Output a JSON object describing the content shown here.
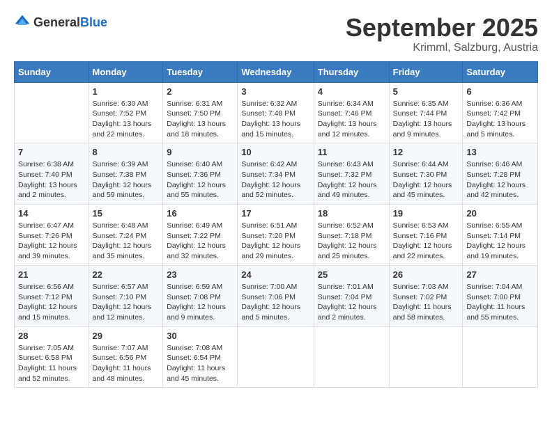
{
  "logo": {
    "general": "General",
    "blue": "Blue"
  },
  "title": "September 2025",
  "location": "Krimml, Salzburg, Austria",
  "days_of_week": [
    "Sunday",
    "Monday",
    "Tuesday",
    "Wednesday",
    "Thursday",
    "Friday",
    "Saturday"
  ],
  "weeks": [
    [
      {
        "day": "",
        "sunrise": "",
        "sunset": "",
        "daylight": ""
      },
      {
        "day": "1",
        "sunrise": "Sunrise: 6:30 AM",
        "sunset": "Sunset: 7:52 PM",
        "daylight": "Daylight: 13 hours and 22 minutes."
      },
      {
        "day": "2",
        "sunrise": "Sunrise: 6:31 AM",
        "sunset": "Sunset: 7:50 PM",
        "daylight": "Daylight: 13 hours and 18 minutes."
      },
      {
        "day": "3",
        "sunrise": "Sunrise: 6:32 AM",
        "sunset": "Sunset: 7:48 PM",
        "daylight": "Daylight: 13 hours and 15 minutes."
      },
      {
        "day": "4",
        "sunrise": "Sunrise: 6:34 AM",
        "sunset": "Sunset: 7:46 PM",
        "daylight": "Daylight: 13 hours and 12 minutes."
      },
      {
        "day": "5",
        "sunrise": "Sunrise: 6:35 AM",
        "sunset": "Sunset: 7:44 PM",
        "daylight": "Daylight: 13 hours and 9 minutes."
      },
      {
        "day": "6",
        "sunrise": "Sunrise: 6:36 AM",
        "sunset": "Sunset: 7:42 PM",
        "daylight": "Daylight: 13 hours and 5 minutes."
      }
    ],
    [
      {
        "day": "7",
        "sunrise": "Sunrise: 6:38 AM",
        "sunset": "Sunset: 7:40 PM",
        "daylight": "Daylight: 13 hours and 2 minutes."
      },
      {
        "day": "8",
        "sunrise": "Sunrise: 6:39 AM",
        "sunset": "Sunset: 7:38 PM",
        "daylight": "Daylight: 12 hours and 59 minutes."
      },
      {
        "day": "9",
        "sunrise": "Sunrise: 6:40 AM",
        "sunset": "Sunset: 7:36 PM",
        "daylight": "Daylight: 12 hours and 55 minutes."
      },
      {
        "day": "10",
        "sunrise": "Sunrise: 6:42 AM",
        "sunset": "Sunset: 7:34 PM",
        "daylight": "Daylight: 12 hours and 52 minutes."
      },
      {
        "day": "11",
        "sunrise": "Sunrise: 6:43 AM",
        "sunset": "Sunset: 7:32 PM",
        "daylight": "Daylight: 12 hours and 49 minutes."
      },
      {
        "day": "12",
        "sunrise": "Sunrise: 6:44 AM",
        "sunset": "Sunset: 7:30 PM",
        "daylight": "Daylight: 12 hours and 45 minutes."
      },
      {
        "day": "13",
        "sunrise": "Sunrise: 6:46 AM",
        "sunset": "Sunset: 7:28 PM",
        "daylight": "Daylight: 12 hours and 42 minutes."
      }
    ],
    [
      {
        "day": "14",
        "sunrise": "Sunrise: 6:47 AM",
        "sunset": "Sunset: 7:26 PM",
        "daylight": "Daylight: 12 hours and 39 minutes."
      },
      {
        "day": "15",
        "sunrise": "Sunrise: 6:48 AM",
        "sunset": "Sunset: 7:24 PM",
        "daylight": "Daylight: 12 hours and 35 minutes."
      },
      {
        "day": "16",
        "sunrise": "Sunrise: 6:49 AM",
        "sunset": "Sunset: 7:22 PM",
        "daylight": "Daylight: 12 hours and 32 minutes."
      },
      {
        "day": "17",
        "sunrise": "Sunrise: 6:51 AM",
        "sunset": "Sunset: 7:20 PM",
        "daylight": "Daylight: 12 hours and 29 minutes."
      },
      {
        "day": "18",
        "sunrise": "Sunrise: 6:52 AM",
        "sunset": "Sunset: 7:18 PM",
        "daylight": "Daylight: 12 hours and 25 minutes."
      },
      {
        "day": "19",
        "sunrise": "Sunrise: 6:53 AM",
        "sunset": "Sunset: 7:16 PM",
        "daylight": "Daylight: 12 hours and 22 minutes."
      },
      {
        "day": "20",
        "sunrise": "Sunrise: 6:55 AM",
        "sunset": "Sunset: 7:14 PM",
        "daylight": "Daylight: 12 hours and 19 minutes."
      }
    ],
    [
      {
        "day": "21",
        "sunrise": "Sunrise: 6:56 AM",
        "sunset": "Sunset: 7:12 PM",
        "daylight": "Daylight: 12 hours and 15 minutes."
      },
      {
        "day": "22",
        "sunrise": "Sunrise: 6:57 AM",
        "sunset": "Sunset: 7:10 PM",
        "daylight": "Daylight: 12 hours and 12 minutes."
      },
      {
        "day": "23",
        "sunrise": "Sunrise: 6:59 AM",
        "sunset": "Sunset: 7:08 PM",
        "daylight": "Daylight: 12 hours and 9 minutes."
      },
      {
        "day": "24",
        "sunrise": "Sunrise: 7:00 AM",
        "sunset": "Sunset: 7:06 PM",
        "daylight": "Daylight: 12 hours and 5 minutes."
      },
      {
        "day": "25",
        "sunrise": "Sunrise: 7:01 AM",
        "sunset": "Sunset: 7:04 PM",
        "daylight": "Daylight: 12 hours and 2 minutes."
      },
      {
        "day": "26",
        "sunrise": "Sunrise: 7:03 AM",
        "sunset": "Sunset: 7:02 PM",
        "daylight": "Daylight: 11 hours and 58 minutes."
      },
      {
        "day": "27",
        "sunrise": "Sunrise: 7:04 AM",
        "sunset": "Sunset: 7:00 PM",
        "daylight": "Daylight: 11 hours and 55 minutes."
      }
    ],
    [
      {
        "day": "28",
        "sunrise": "Sunrise: 7:05 AM",
        "sunset": "Sunset: 6:58 PM",
        "daylight": "Daylight: 11 hours and 52 minutes."
      },
      {
        "day": "29",
        "sunrise": "Sunrise: 7:07 AM",
        "sunset": "Sunset: 6:56 PM",
        "daylight": "Daylight: 11 hours and 48 minutes."
      },
      {
        "day": "30",
        "sunrise": "Sunrise: 7:08 AM",
        "sunset": "Sunset: 6:54 PM",
        "daylight": "Daylight: 11 hours and 45 minutes."
      },
      {
        "day": "",
        "sunrise": "",
        "sunset": "",
        "daylight": ""
      },
      {
        "day": "",
        "sunrise": "",
        "sunset": "",
        "daylight": ""
      },
      {
        "day": "",
        "sunrise": "",
        "sunset": "",
        "daylight": ""
      },
      {
        "day": "",
        "sunrise": "",
        "sunset": "",
        "daylight": ""
      }
    ]
  ]
}
